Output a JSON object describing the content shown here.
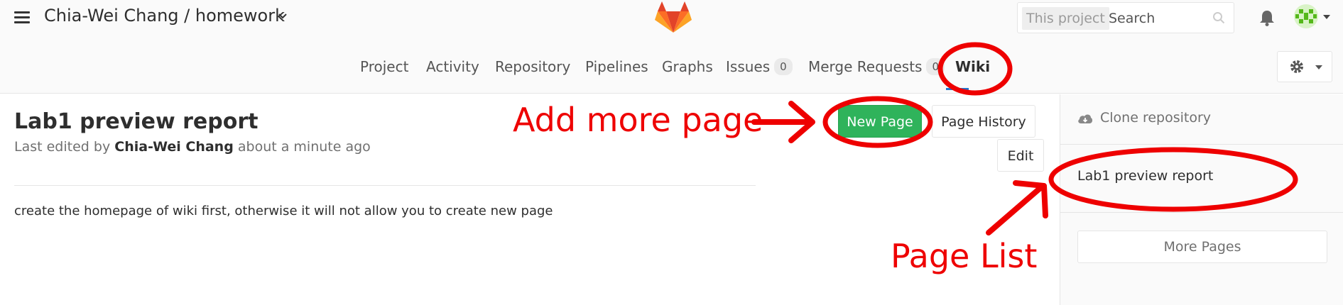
{
  "header": {
    "project_title": "Chia-Wei Chang / homework",
    "search": {
      "scope": "This project",
      "placeholder": "Search"
    }
  },
  "nav": {
    "items": [
      {
        "label": "Project"
      },
      {
        "label": "Activity"
      },
      {
        "label": "Repository"
      },
      {
        "label": "Pipelines"
      },
      {
        "label": "Graphs"
      },
      {
        "label": "Issues",
        "count": "0"
      },
      {
        "label": "Merge Requests",
        "count": "0"
      },
      {
        "label": "Wiki",
        "active": true
      }
    ]
  },
  "page": {
    "title": "Lab1 preview report",
    "edited_prefix": "Last edited by",
    "author": "Chia-Wei Chang",
    "edited_suffix": "about a minute ago",
    "body": "create the homepage of wiki first, otherwise it will not allow you to create new page",
    "buttons": {
      "new_page": "New Page",
      "page_history": "Page History",
      "edit": "Edit"
    }
  },
  "sidebar": {
    "clone_label": "Clone repository",
    "pages": [
      "Lab1 preview report"
    ],
    "more_pages": "More Pages"
  },
  "annotations": {
    "add_more_page": "Add more page",
    "page_list": "Page List",
    "color": "#ee0000"
  },
  "colors": {
    "accent_green": "#2fb35b",
    "active_tab_underline": "#1f78d1"
  }
}
